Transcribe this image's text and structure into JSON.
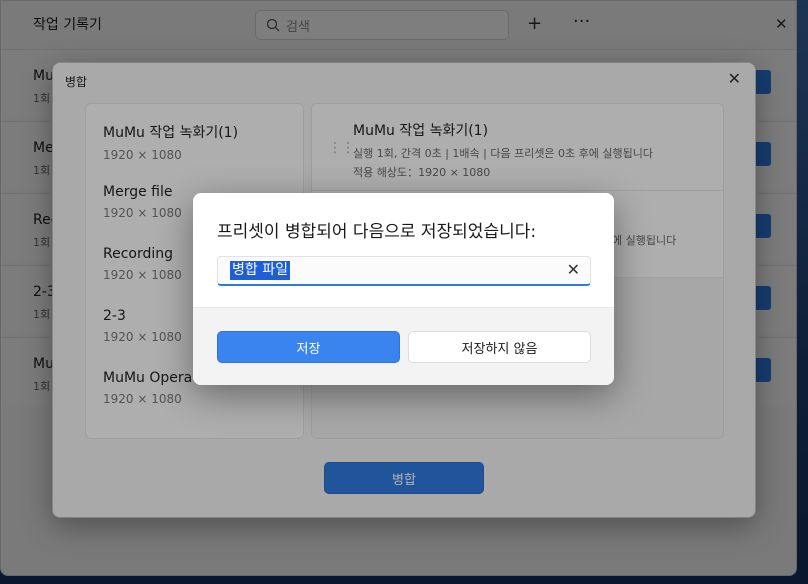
{
  "main": {
    "title": "작업 기록기",
    "search_placeholder": "검색",
    "add_icon": "+",
    "more_icon": "···",
    "close_icon": "✕",
    "items": [
      {
        "name": "Mu",
        "sub": "1회"
      },
      {
        "name": "Me",
        "sub": "1회"
      },
      {
        "name": "Rec",
        "sub": "1회"
      },
      {
        "name": "2-3",
        "sub": "1회"
      },
      {
        "name": "Mu",
        "sub": "1회"
      }
    ]
  },
  "merge_dialog": {
    "title": "병합",
    "close_icon": "✕",
    "left_presets": [
      {
        "name": "MuMu 작업 녹화기(1)",
        "res": "1920 × 1080"
      },
      {
        "name": "Merge file",
        "res": "1920 × 1080"
      },
      {
        "name": "Recording",
        "res": "1920 × 1080"
      },
      {
        "name": "2-3",
        "res": "1920 × 1080"
      },
      {
        "name": "MuMu Opera",
        "res": "1920 × 1080"
      }
    ],
    "right_items": [
      {
        "name": "MuMu 작업 녹화기(1)",
        "detail": "실행 1회, 간격 0초 | 1배속 | 다음 프리셋은 0초 후에 실행됩니다",
        "res": "적용 해상도：1920 × 1080"
      },
      {
        "name": "",
        "detail": "에 실행됩니다",
        "res": ""
      }
    ],
    "merge_button": "병합"
  },
  "save_modal": {
    "message": "프리셋이 병합되어 다음으로 저장되었습니다:",
    "input_value": "병합 파일",
    "clear_icon": "✕",
    "save_button": "저장",
    "dont_save_button": "저장하지 않음"
  },
  "colors": {
    "accent": "#2f7ae0"
  }
}
